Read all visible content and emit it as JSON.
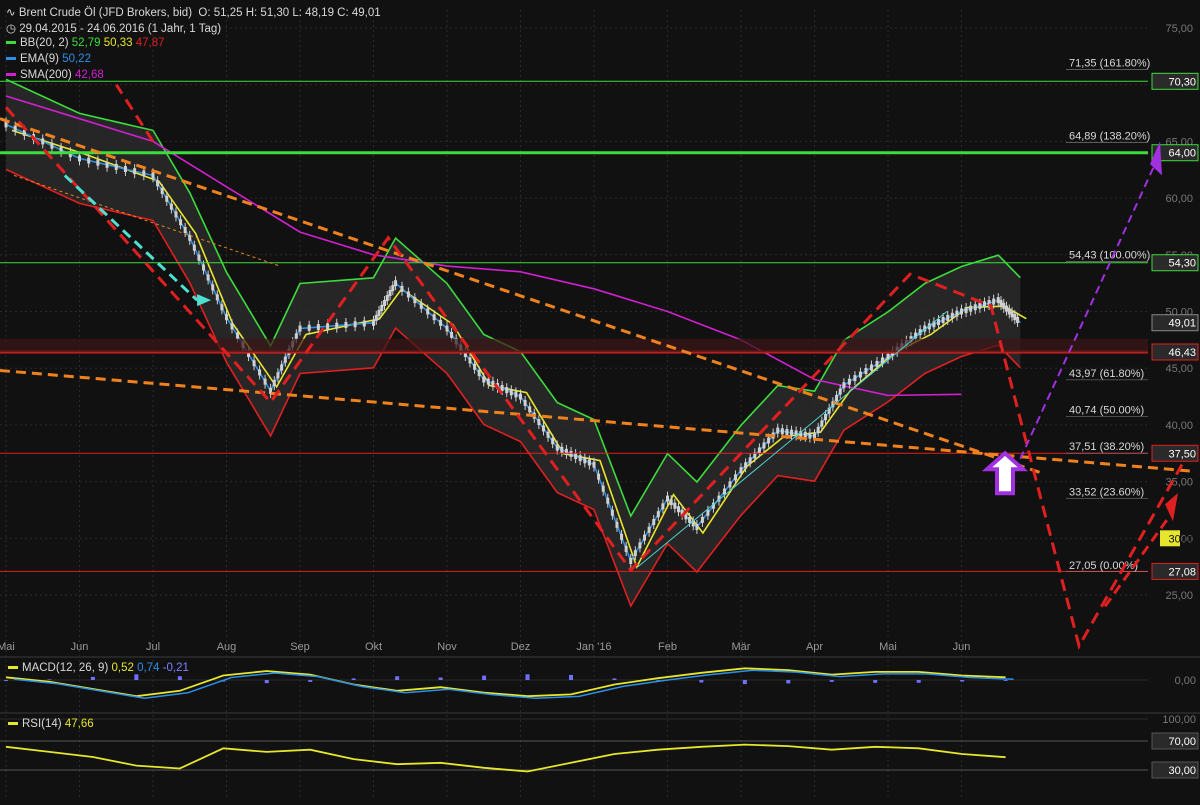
{
  "header": {
    "instrument": "Brent Crude Öl (JFD Brokers, bid)",
    "ohlc": "O: 51,25  H: 51,30  L: 48,19  C: 49,01",
    "period": "29.04.2015 - 24.06.2016 (1 Jahr, 1 Tag)",
    "indicators": [
      {
        "label": "BB(20, 2)",
        "values": [
          "52,79",
          "50,33",
          "47,87"
        ],
        "colors": [
          "#3ddc3d",
          "#e6e62e",
          "#e02020"
        ]
      },
      {
        "label": "EMA(9)",
        "values": [
          "50,22"
        ],
        "colors": [
          "#2b8fe6"
        ]
      },
      {
        "label": "SMA(200)",
        "values": [
          "42,68"
        ],
        "colors": [
          "#d020d0"
        ]
      }
    ]
  },
  "colors": {
    "background": "#111111",
    "grid": "#2a2a2a",
    "price_up": "#d0d0d0",
    "bb_upper": "#3ddc3d",
    "bb_middle": "#e6e62e",
    "bb_lower": "#e02020",
    "ema": "#2b8fe6",
    "sma": "#d020d0",
    "trend_orange": "#f0821e",
    "trend_red": "#e02020",
    "target_purple": "#a030e0",
    "line_green": "#3ddc3d",
    "level_red": "#e02020"
  },
  "chart_data": [
    {
      "type": "candlestick",
      "title": "Brent Crude Öl (JFD Brokers, bid)",
      "y_axis_position": "right",
      "ylim": [
        23,
        78
      ],
      "y_ticks": [
        "75,00",
        "70,00",
        "65,00",
        "60,00",
        "55,00",
        "50,00",
        "45,00",
        "40,00",
        "35,00",
        "30,00",
        "25,00"
      ],
      "x_ticks": [
        "Mai",
        "Jun",
        "Jul",
        "Aug",
        "Sep",
        "Okt",
        "Nov",
        "Dez",
        "Jan '16",
        "Feb",
        "Mär",
        "Apr",
        "Mai",
        "Jun"
      ],
      "price_labels": [
        {
          "value": 70.3,
          "text": "70,30",
          "color": "#3ddc3d"
        },
        {
          "value": 64.0,
          "text": "64,00",
          "color": "#3ddc3d"
        },
        {
          "value": 54.3,
          "text": "54,30",
          "color": "#3ddc3d"
        },
        {
          "value": 49.01,
          "text": "49,01",
          "color": "#888888"
        },
        {
          "value": 46.43,
          "text": "46,43",
          "color": "#e02020"
        },
        {
          "value": 37.5,
          "text": "37,50",
          "color": "#e02020"
        },
        {
          "value": 30.0,
          "text": "30,00",
          "color": "#e6e62e"
        },
        {
          "value": 27.08,
          "text": "27,08",
          "color": "#e02020"
        }
      ],
      "fib_levels": [
        {
          "value": 71.35,
          "text": "71,35 (161.80%)"
        },
        {
          "value": 64.89,
          "text": "64,89 (138.20%)"
        },
        {
          "value": 54.43,
          "text": "54,43 (100.00%)"
        },
        {
          "value": 43.97,
          "text": "43,97 (61.80%)"
        },
        {
          "value": 40.74,
          "text": "40,74 (50.00%)"
        },
        {
          "value": 37.51,
          "text": "37,51 (38.20%)"
        },
        {
          "value": 33.52,
          "text": "33,52 (23.60%)"
        },
        {
          "value": 27.05,
          "text": "27,05 (0.00%)"
        }
      ],
      "horizontal_lines": [
        {
          "value": 70.3,
          "color": "#3ddc3d",
          "width": 1
        },
        {
          "value": 64.0,
          "color": "#3ddc3d",
          "width": 3
        },
        {
          "value": 54.3,
          "color": "#3ddc3d",
          "width": 1
        },
        {
          "value": 46.43,
          "color": "#e02020",
          "width": 3
        },
        {
          "value": 37.5,
          "color": "#e02020",
          "width": 1
        },
        {
          "value": 27.08,
          "color": "#e02020",
          "width": 1
        }
      ],
      "close_series": [
        {
          "month": "Mai",
          "x": 0.0,
          "y": 66.5
        },
        {
          "month": "Jun",
          "x": 1.0,
          "y": 63.5
        },
        {
          "month": "Jul",
          "x": 2.0,
          "y": 62.0
        },
        {
          "month": "",
          "x": 2.5,
          "y": 56.5
        },
        {
          "month": "Aug",
          "x": 3.0,
          "y": 49.5
        },
        {
          "month": "",
          "x": 3.6,
          "y": 43.0
        },
        {
          "month": "Sep",
          "x": 4.0,
          "y": 48.5
        },
        {
          "month": "Okt",
          "x": 5.0,
          "y": 49.0
        },
        {
          "month": "",
          "x": 5.3,
          "y": 52.5
        },
        {
          "month": "Nov",
          "x": 6.0,
          "y": 48.5
        },
        {
          "month": "",
          "x": 6.5,
          "y": 44.0
        },
        {
          "month": "Dez",
          "x": 7.0,
          "y": 42.5
        },
        {
          "month": "",
          "x": 7.5,
          "y": 38.0
        },
        {
          "month": "Jan '16",
          "x": 8.0,
          "y": 36.5
        },
        {
          "month": "",
          "x": 8.5,
          "y": 28.0
        },
        {
          "month": "Feb",
          "x": 9.0,
          "y": 33.5
        },
        {
          "month": "",
          "x": 9.4,
          "y": 31.0
        },
        {
          "month": "Mär",
          "x": 10.0,
          "y": 36.0
        },
        {
          "month": "",
          "x": 10.5,
          "y": 39.5
        },
        {
          "month": "Apr",
          "x": 11.0,
          "y": 39.0
        },
        {
          "month": "",
          "x": 11.4,
          "y": 43.5
        },
        {
          "month": "Mai",
          "x": 12.0,
          "y": 46.0
        },
        {
          "month": "",
          "x": 12.5,
          "y": 48.5
        },
        {
          "month": "Jun",
          "x": 13.0,
          "y": 50.0
        },
        {
          "month": "",
          "x": 13.5,
          "y": 51.0
        },
        {
          "month": "",
          "x": 13.8,
          "y": 49.01
        }
      ]
    },
    {
      "type": "line",
      "title": "MACD(12, 26, 9)",
      "values_text": [
        "0,52",
        "0,74",
        "-0,21"
      ],
      "y_ticks": [
        "0,00"
      ]
    },
    {
      "type": "line",
      "title": "RSI(14)",
      "values_text": [
        "47,66"
      ],
      "y_ticks": [
        "100,00",
        "70,00",
        "30,00"
      ]
    }
  ]
}
